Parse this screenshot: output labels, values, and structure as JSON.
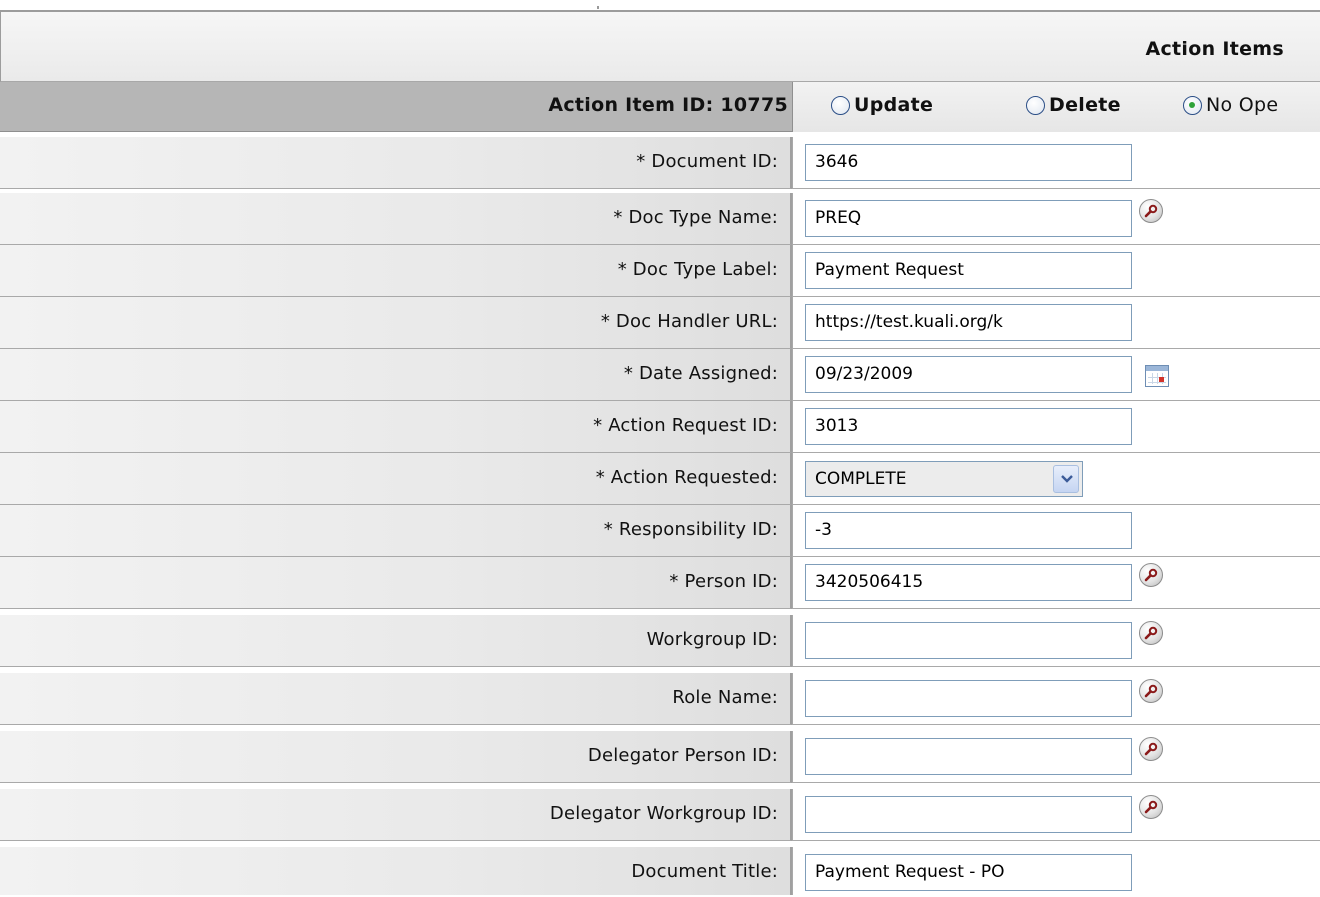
{
  "section": {
    "title": "Action Items"
  },
  "action_item": {
    "id_label": "Action Item ID: 10775",
    "operations": [
      {
        "label": "Update",
        "checked": false
      },
      {
        "label": "Delete",
        "checked": false
      },
      {
        "label": "No Ope",
        "checked": true
      }
    ]
  },
  "fields": [
    {
      "label": "* Document ID:",
      "value": "3646"
    },
    {
      "label": "* Doc Type Name:",
      "value": "PREQ",
      "icon": "lookup-icon"
    },
    {
      "label": "* Doc Type Label:",
      "value": "Payment Request"
    },
    {
      "label": "* Doc Handler URL:",
      "value": "https://test.kuali.org/k"
    },
    {
      "label": "* Date Assigned:",
      "value": "09/23/2009",
      "icon": "calendar-icon"
    },
    {
      "label": "* Action Request ID:",
      "value": "3013"
    },
    {
      "label": "* Action Requested:",
      "value": "COMPLETE",
      "control": "select"
    },
    {
      "label": "* Responsibility ID:",
      "value": "-3"
    },
    {
      "label": "* Person ID:",
      "value": "3420506415",
      "icon": "lookup-icon"
    },
    {
      "label": "Workgroup ID:",
      "value": "",
      "icon": "lookup-icon"
    },
    {
      "label": "Role Name:",
      "value": "",
      "icon": "lookup-icon"
    },
    {
      "label": "Delegator Person ID:",
      "value": "",
      "icon": "lookup-icon"
    },
    {
      "label": "Delegator Workgroup ID:",
      "value": "",
      "icon": "lookup-icon"
    },
    {
      "label": "Document Title:",
      "value": "Payment Request - PO"
    }
  ],
  "colors": {
    "header_bg": "#eeeeee",
    "item_row_bg": "#b6b6b6",
    "input_border": "#7f9db9",
    "radio_checked": "#2fa33a"
  }
}
